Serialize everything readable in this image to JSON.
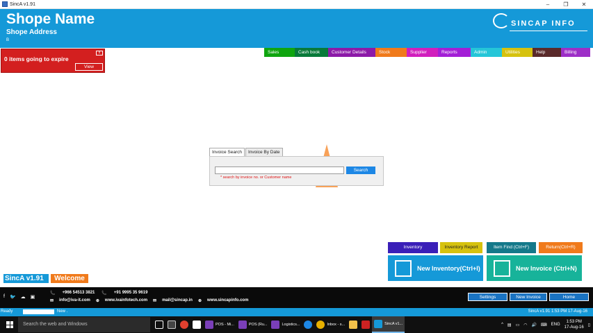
{
  "window": {
    "title": "SincA v1.91"
  },
  "header": {
    "shop_name": "Shope Name",
    "shop_address": "Shope Address",
    "shop_sub": "B",
    "logo_text": "SINCAP INFO"
  },
  "menu": [
    {
      "label": "Sales",
      "color": "#0fa50f"
    },
    {
      "label": "Cash book",
      "color": "#087a3a"
    },
    {
      "label": "Customer Details",
      "color": "#8c1aa8"
    },
    {
      "label": "Stock",
      "color": "#f07a1b"
    },
    {
      "label": "Supplier",
      "color": "#d11fbd"
    },
    {
      "label": "Reports",
      "color": "#a31fd6"
    },
    {
      "label": "Admin",
      "color": "#25c6d8"
    },
    {
      "label": "Utilities",
      "color": "#d6c20e"
    },
    {
      "label": "Help",
      "color": "#5a2a2a"
    },
    {
      "label": "Billing",
      "color": "#9d2fc7"
    }
  ],
  "alert": {
    "message": "0 items going to expire",
    "close": "x",
    "view": "View"
  },
  "search": {
    "tabs": [
      "Invoice Search",
      "Invoice By Date"
    ],
    "button": "Search",
    "hint": "* search by invoice no. or Customer name",
    "value": ""
  },
  "actions": {
    "inventory": "Inventory",
    "inventory_report": "Inventory Report",
    "item_find": "Item Find (Ctrl+F)",
    "return": "Return(Ctrl+R)",
    "new_inventory": "New Inventory(Ctrl+I)",
    "new_invoice": "New Invoice (Ctrl+N)"
  },
  "badges": {
    "version": "SincA v1.91",
    "welcome": "Welcome"
  },
  "footer": {
    "phone1": "+966 54513 3821",
    "phone2": "+91 9995 35 9619",
    "email1": "info@iva-it.com",
    "web1": "www.ivainfotech.com",
    "email2": "mail@sincap.in",
    "web2": "www.sincapinfo.com",
    "settings": "Settings",
    "new_invoice": "New Invoice",
    "home": "Home"
  },
  "status": {
    "ready": "Ready",
    "new": "New .",
    "right": "SincA v1.91   1:53 PM   17-Aug-16"
  },
  "taskbar": {
    "search_placeholder": "Search the web and Windows",
    "items": [
      "POS - Mi...",
      "POS (Ru...",
      "Logistics...",
      "Inbox - s...",
      "SincA v1..."
    ],
    "lang": "ENG",
    "time": "1:53 PM",
    "date": "17-Aug-16"
  }
}
